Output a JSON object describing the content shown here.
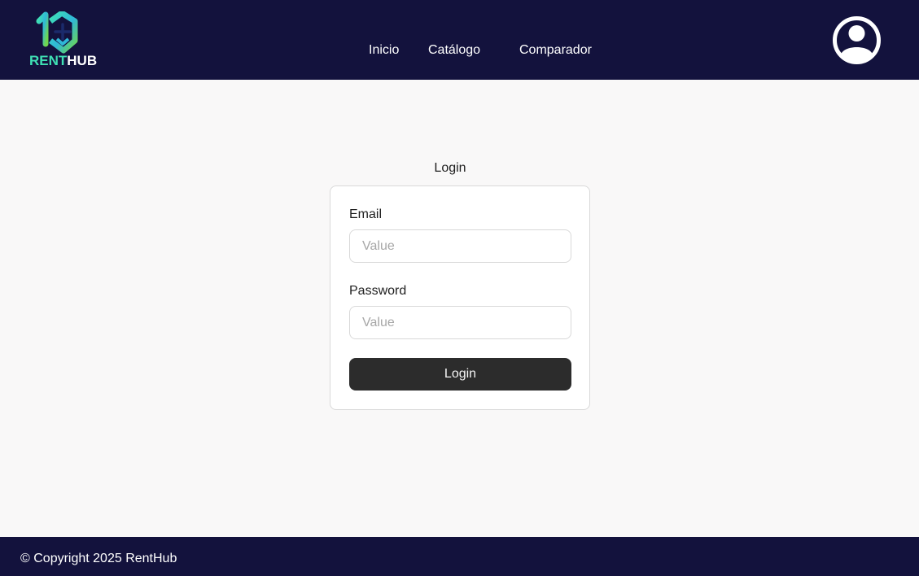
{
  "header": {
    "brand": {
      "part1": "RENT",
      "part2": "HUB"
    },
    "nav": [
      {
        "label": "Inicio"
      },
      {
        "label": "Catálogo"
      },
      {
        "label": "Comparador"
      }
    ],
    "profile_icon": "user-circle-icon"
  },
  "login": {
    "title": "Login",
    "email": {
      "label": "Email",
      "placeholder": "Value",
      "value": ""
    },
    "password": {
      "label": "Password",
      "placeholder": "Value",
      "value": ""
    },
    "button_label": "Login"
  },
  "footer": {
    "copyright": "© Copyright 2025 RentHub"
  },
  "colors": {
    "header_bg": "#13123d",
    "page_bg": "#f9f8f8",
    "brand_teal": "#3fe0b4",
    "button_bg": "#2c2c2c"
  }
}
